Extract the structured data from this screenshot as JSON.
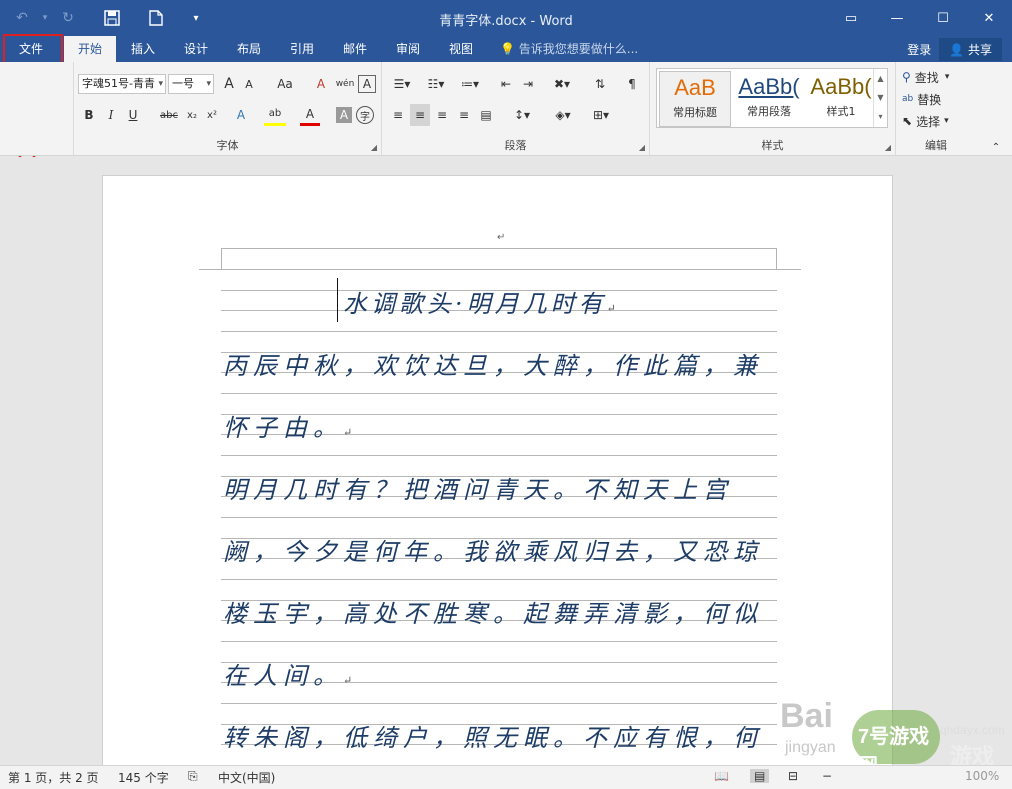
{
  "titlebar": {
    "title": "青青字体.docx - Word",
    "qat": {
      "undo": "↶",
      "undo_arrow": "▾",
      "redo": "↻",
      "save": "🖫",
      "new": "🗋",
      "customize": "▾"
    },
    "window": {
      "ribbon_options": "▭",
      "minimize": "—",
      "restore": "☐",
      "close": "✕"
    }
  },
  "tabs": {
    "file": "文件",
    "items": [
      "开始",
      "插入",
      "设计",
      "布局",
      "引用",
      "邮件",
      "审阅",
      "视图"
    ],
    "active": "开始",
    "tell_me": "告诉我您想要做什么...",
    "login": "登录",
    "share": "共享"
  },
  "ribbon": {
    "font": {
      "label": "字体",
      "font_name": "字魂51号-青青",
      "font_size": "一号",
      "grow": "A",
      "shrink": "A",
      "case": "Aa",
      "clear": "A",
      "pinyin": "wén",
      "border": "A",
      "bold": "B",
      "italic": "I",
      "underline": "U",
      "strike": "abc",
      "subscript": "x₂",
      "superscript": "x²",
      "effects": "A",
      "highlight": "ab",
      "color": "A",
      "shading": "A",
      "circle": "字"
    },
    "paragraph": {
      "label": "段落"
    },
    "styles": {
      "label": "样式",
      "items": [
        {
          "sample": "AaB",
          "name": "常用标题",
          "color": "#e36c09"
        },
        {
          "sample": "AaBb(",
          "name": "常用段落",
          "color": "#1f497d"
        },
        {
          "sample": "AaBb(",
          "name": "样式1",
          "color": "#7f6000"
        }
      ]
    },
    "editing": {
      "label": "编辑",
      "find": "查找",
      "replace": "替换",
      "select": "选择"
    }
  },
  "document": {
    "header_mark": "↵",
    "title": "水调歌头·明月几时有",
    "lines": [
      "丙辰中秋，欢饮达旦，大醉，作此篇，兼",
      "怀子由。",
      "明月几时有？把酒问青天。不知天上宫",
      "阙，今夕是何年。我欲乘风归去，又恐琼",
      "楼玉宇，高处不胜寒。起舞弄清影，何似",
      "在人间。",
      "转朱阁，低绮户，照无眠。不应有恨，何"
    ]
  },
  "status": {
    "page": "第 1 页，共 2 页",
    "words": "145 个字",
    "language": "中文(中国)",
    "zoom": "100%"
  },
  "watermark": {
    "baidu": "Bai",
    "jingyan": "jingyan",
    "site": "7号游戏网",
    "site_url": "qhdayx.com",
    "game": "游戏"
  },
  "colors": {
    "word_blue": "#2b579a",
    "annotation_red": "#e02020",
    "ink": "#1d3c66"
  }
}
